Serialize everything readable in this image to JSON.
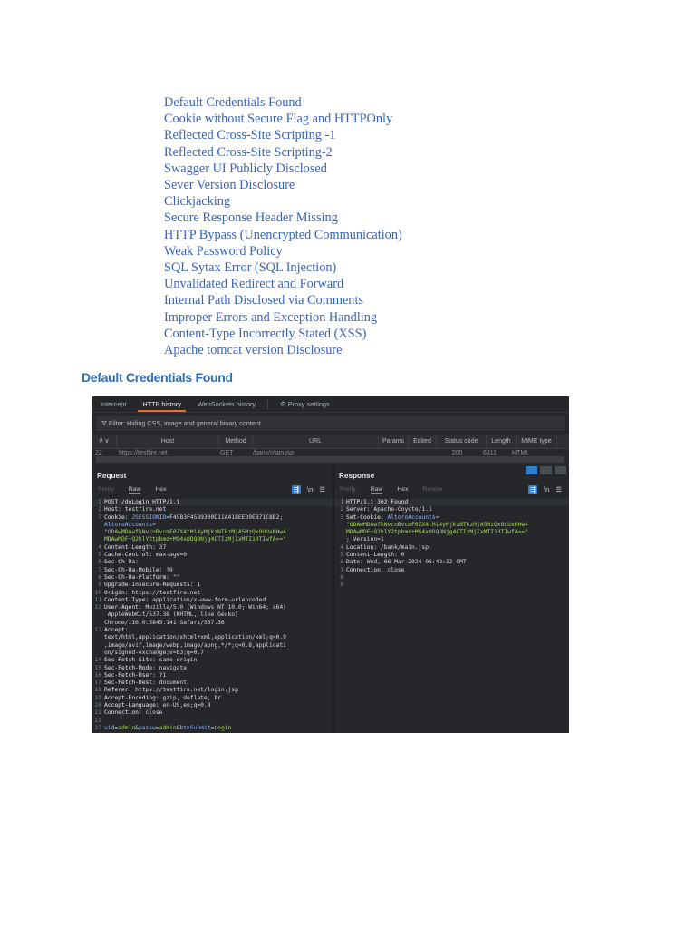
{
  "toc": [
    "Default Credentials Found",
    "Cookie without Secure Flag and HTTPOnly",
    "Reflected Cross-Site Scripting -1",
    "Reflected Cross-Site Scripting-2",
    "Swagger UI Publicly Disclosed",
    "Sever Version Disclosure",
    "Clickjacking",
    "Secure Response Header Missing",
    "HTTP Bypass (Unencrypted Communication)",
    "Weak Password Policy",
    "SQL Sytax Error (SQL Injection)",
    "Unvalidated Redirect and Forward",
    "Internal Path Disclosed via Comments",
    "Improper Errors and Exception Handling",
    "Content-Type Incorrectly Stated (XSS)",
    "Apache tomcat version Disclosure"
  ],
  "section_heading": "Default Credentials Found",
  "burp": {
    "tabs": [
      "Intercept",
      "HTTP history",
      "WebSockets history"
    ],
    "proxy_settings": "Proxy settings",
    "filter": "Filter: Hiding CSS, image and general binary content",
    "columns": [
      "# ∨",
      "Host",
      "Method",
      "URL",
      "Params",
      "Edited",
      "Status code",
      "Length",
      "MIME type"
    ],
    "row": [
      "22",
      "https://testfire.net",
      "GET",
      "/bank/main.jsp",
      "",
      "",
      "200",
      "6311",
      "HTML"
    ],
    "request": {
      "title": "Request",
      "tabs": [
        "Pretty",
        "Raw",
        "Hex"
      ],
      "lines": [
        [
          [
            "1",
            "ln"
          ],
          [
            "POST /doLogin HTTP/1.1",
            "k"
          ]
        ],
        [
          [
            "2",
            "ln"
          ],
          [
            "Host: ",
            "k"
          ],
          [
            "testfire.net",
            ""
          ]
        ],
        [
          [
            "3",
            "ln"
          ],
          [
            "Cookie: ",
            "k"
          ],
          [
            "JSESSIONID",
            "blue"
          ],
          [
            "=",
            ""
          ],
          [
            "F45B3F4589300D11A418EED9EB71C8B2",
            ""
          ],
          [
            ";",
            ""
          ]
        ],
        [
          [
            "",
            "ln"
          ],
          [
            "AltoroAccounts=",
            "blue"
          ]
        ],
        [
          [
            "",
            "ln"
          ],
          [
            "\"ODAwMDAwfkNvcnBvcmF0ZX4tMi4yMjkzNTkzMjA5MzQxOUUxNHw4",
            "green"
          ]
        ],
        [
          [
            "",
            "ln"
          ],
          [
            "MDAwMDF+Q2hlY2tpbmd+MS4xODQ0Njg4OTIzMjIxMTI1RTIwfA==\"",
            "green"
          ]
        ],
        [
          [
            "4",
            "ln"
          ],
          [
            "Content-Length: ",
            "k"
          ],
          [
            "37",
            ""
          ]
        ],
        [
          [
            "5",
            "ln"
          ],
          [
            "Cache-Control: ",
            "k"
          ],
          [
            "max-age=0",
            ""
          ]
        ],
        [
          [
            "6",
            "ln"
          ],
          [
            "Sec-Ch-Ua:",
            "k"
          ]
        ],
        [
          [
            "7",
            "ln"
          ],
          [
            "Sec-Ch-Ua-Mobile: ",
            "k"
          ],
          [
            "?0",
            ""
          ]
        ],
        [
          [
            "8",
            "ln"
          ],
          [
            "Sec-Ch-Ua-Platform: ",
            "k"
          ],
          [
            "\"\"",
            ""
          ]
        ],
        [
          [
            "9",
            "ln"
          ],
          [
            "Upgrade-Insecure-Requests: ",
            "k"
          ],
          [
            "1",
            ""
          ]
        ],
        [
          [
            "10",
            "ln"
          ],
          [
            "Origin: ",
            "k"
          ],
          [
            "https://testfire.net",
            ""
          ]
        ],
        [
          [
            "11",
            "ln"
          ],
          [
            "Content-Type: ",
            "k"
          ],
          [
            "application/x-www-form-urlencoded",
            ""
          ]
        ],
        [
          [
            "12",
            "ln"
          ],
          [
            "User-Agent: ",
            "k"
          ],
          [
            "Mozilla/5.0 (Windows NT 10.0; Win64; x64)",
            ""
          ]
        ],
        [
          [
            "",
            "ln"
          ],
          [
            " AppleWebKit/537.36 (KHTML, like Gecko)",
            ""
          ]
        ],
        [
          [
            "",
            "ln"
          ],
          [
            "Chrome/116.0.5845.141 Safari/537.36",
            ""
          ]
        ],
        [
          [
            "13",
            "ln"
          ],
          [
            "Accept:",
            "k"
          ]
        ],
        [
          [
            "",
            "ln"
          ],
          [
            "text/html,application/xhtml+xml,application/xml;q=0.9",
            ""
          ]
        ],
        [
          [
            "",
            "ln"
          ],
          [
            ",image/avif,image/webp,image/apng,*/*;q=0.8,applicati",
            ""
          ]
        ],
        [
          [
            "",
            "ln"
          ],
          [
            "on/signed-exchange;v=b3;q=0.7",
            ""
          ]
        ],
        [
          [
            "14",
            "ln"
          ],
          [
            "Sec-Fetch-Site: ",
            "k"
          ],
          [
            "same-origin",
            ""
          ]
        ],
        [
          [
            "15",
            "ln"
          ],
          [
            "Sec-Fetch-Mode: ",
            "k"
          ],
          [
            "navigate",
            ""
          ]
        ],
        [
          [
            "16",
            "ln"
          ],
          [
            "Sec-Fetch-User: ",
            "k"
          ],
          [
            "?1",
            ""
          ]
        ],
        [
          [
            "17",
            "ln"
          ],
          [
            "Sec-Fetch-Dest: ",
            "k"
          ],
          [
            "document",
            ""
          ]
        ],
        [
          [
            "18",
            "ln"
          ],
          [
            "Referer: ",
            "k"
          ],
          [
            "https://testfire.net/login.jsp",
            ""
          ]
        ],
        [
          [
            "19",
            "ln"
          ],
          [
            "Accept-Encoding: ",
            "k"
          ],
          [
            "gzip, deflate, br",
            ""
          ]
        ],
        [
          [
            "20",
            "ln"
          ],
          [
            "Accept-Language: ",
            "k"
          ],
          [
            "en-US,en;q=0.9",
            ""
          ]
        ],
        [
          [
            "21",
            "ln"
          ],
          [
            "Connection: ",
            "k"
          ],
          [
            "close",
            ""
          ]
        ],
        [
          [
            "22",
            "ln"
          ]
        ],
        [
          [
            "23",
            "ln"
          ],
          [
            "uid",
            "blue"
          ],
          [
            "=",
            ""
          ],
          [
            "admin",
            "green"
          ],
          [
            "&",
            ""
          ],
          [
            "passw",
            "blue"
          ],
          [
            "=",
            ""
          ],
          [
            "admin",
            "green"
          ],
          [
            "&",
            ""
          ],
          [
            "btnSubmit",
            "blue"
          ],
          [
            "=",
            ""
          ],
          [
            "Login",
            "green"
          ]
        ]
      ]
    },
    "response": {
      "title": "Response",
      "tabs": [
        "Pretty",
        "Raw",
        "Hex",
        "Render"
      ],
      "lines": [
        [
          [
            "1",
            "ln"
          ],
          [
            "HTTP/1.1 302 Found",
            "k"
          ]
        ],
        [
          [
            "2",
            "ln"
          ],
          [
            "Server: ",
            "k"
          ],
          [
            "Apache-Coyote/1.1",
            ""
          ]
        ],
        [
          [
            "3",
            "ln"
          ],
          [
            "Set-Cookie: ",
            "k"
          ],
          [
            "AltoroAccounts=",
            "blue"
          ]
        ],
        [
          [
            "",
            "ln"
          ],
          [
            "\"ODAwMDAwfkNvcnBvcmF0ZX4tMi4yMjkzNTkzMjA5MzQxOUUxNHw4",
            "green"
          ]
        ],
        [
          [
            "",
            "ln"
          ],
          [
            "MDAwMDF+Q2hlY2tpbmd+MS4xODQ0Njg4OTIzMjIxMTI1RTIwfA==\"",
            "green"
          ]
        ],
        [
          [
            "",
            "ln"
          ],
          [
            "; Version=1",
            ""
          ]
        ],
        [
          [
            "4",
            "ln"
          ],
          [
            "Location: ",
            "k"
          ],
          [
            "/bank/main.jsp",
            ""
          ]
        ],
        [
          [
            "5",
            "ln"
          ],
          [
            "Content-Length: ",
            "k"
          ],
          [
            "0",
            ""
          ]
        ],
        [
          [
            "6",
            "ln"
          ],
          [
            "Date: ",
            "k"
          ],
          [
            "Wed, 06 Mar 2024 06:42:32 GMT",
            ""
          ]
        ],
        [
          [
            "7",
            "ln"
          ],
          [
            "Connection: ",
            "k"
          ],
          [
            "close",
            ""
          ]
        ],
        [
          [
            "8",
            "ln"
          ]
        ],
        [
          [
            "9",
            "ln"
          ]
        ]
      ]
    }
  }
}
